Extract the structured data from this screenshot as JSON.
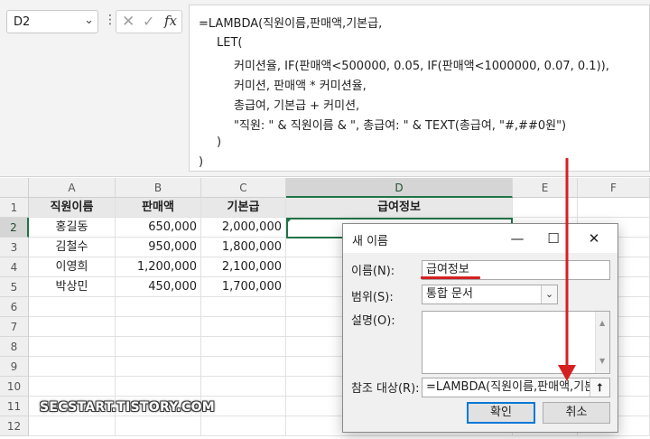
{
  "formula_bar": {
    "name_box": "D2",
    "name_box_arrow": "⌄",
    "dots": "⋮",
    "cancel_glyph": "✕",
    "enter_glyph": "✓",
    "fx_label": "fx",
    "formula_lines": [
      "=LAMBDA(직원이름,판매액,기본급,",
      "LET(",
      "커미션율, IF(판매액<500000, 0.05, IF(판매액<1000000, 0.07, 0.1)),",
      "커미션, 판매액 * 커미션율,",
      "총급여, 기본급 + 커미션,",
      "\"직원: \" & 직원이름 & \", 총급여: \" & TEXT(총급여, \"#,##0원\")",
      ")",
      ")"
    ]
  },
  "sheet": {
    "columns": [
      "A",
      "B",
      "C",
      "D",
      "E",
      "F"
    ],
    "rows": [
      "1",
      "2",
      "3",
      "4",
      "5",
      "6",
      "7",
      "8",
      "9",
      "10",
      "11",
      "12"
    ],
    "header_row": [
      "직원이름",
      "판매액",
      "기본급",
      "급여정보"
    ],
    "data_rows": [
      [
        "홍길동",
        "650,000",
        "2,000,000"
      ],
      [
        "김철수",
        "950,000",
        "1,800,000"
      ],
      [
        "이영희",
        "1,200,000",
        "2,100,000"
      ],
      [
        "박상민",
        "450,000",
        "1,700,000"
      ]
    ],
    "active_cell": "D2"
  },
  "dialog": {
    "title": "새 이름",
    "minimize": "—",
    "maximize": "☐",
    "close": "✕",
    "name_label": "이름(N):",
    "name_value": "급여정보",
    "scope_label": "범위(S):",
    "scope_value": "통합 문서",
    "comment_label": "설명(O):",
    "refers_label": "참조 대상(R):",
    "refers_value": "=LAMBDA(직원이름,판매액,기본급",
    "ok_label": "확인",
    "cancel_label": "취소"
  },
  "watermark": "SECSTART.TISTORY.COM",
  "colors": {
    "excel_green": "#217346",
    "annotation_red": "#d42020",
    "default_button_border": "#0078d7"
  }
}
